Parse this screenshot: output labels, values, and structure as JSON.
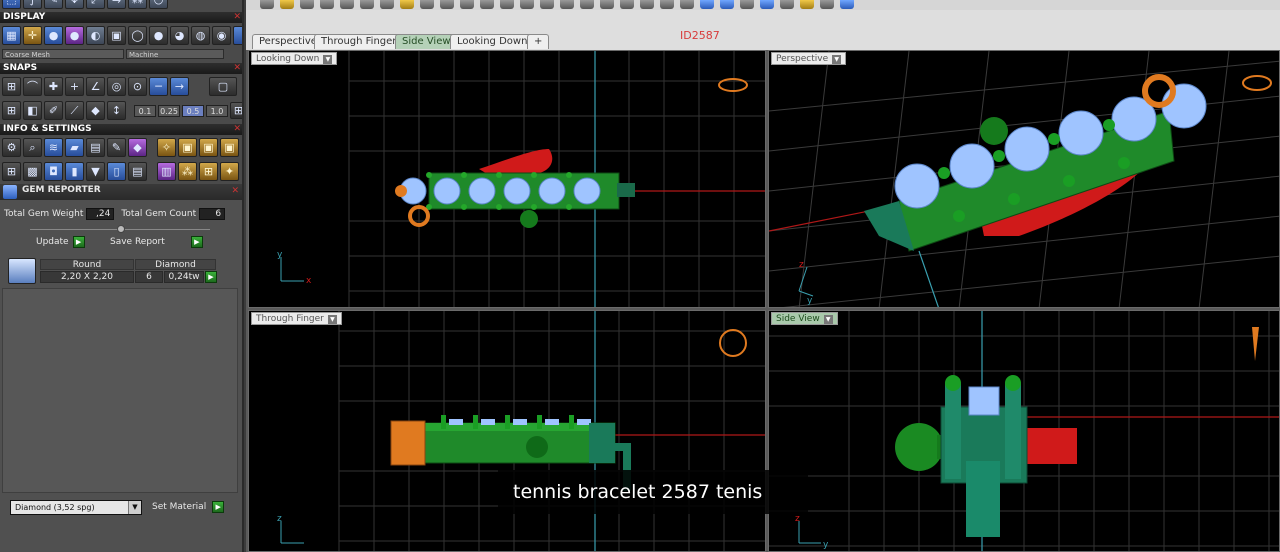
{
  "sections": {
    "display": "DISPLAY",
    "snaps": "SNAPS",
    "info": "INFO & SETTINGS",
    "gem_reporter": "GEM REPORTER"
  },
  "display": {
    "mesh_quality": "Coarse Mesh",
    "render_mode": "Machine"
  },
  "snaps": {
    "steps": [
      "0.1",
      "0.25",
      "0.5",
      "1.0"
    ],
    "selected_step": "0.5"
  },
  "gem_reporter": {
    "total_weight_label": "Total Gem Weight",
    "total_weight_value": ",24",
    "total_count_label": "Total Gem Count",
    "total_count_value": "6",
    "update_label": "Update",
    "save_report_label": "Save Report",
    "table": {
      "headers": [
        "Round",
        "Diamond"
      ],
      "row": {
        "size": "2,20 X 2,20",
        "count": "6",
        "weight": "0,24tw"
      }
    },
    "material_select": "Diamond    (3,52 spg)",
    "set_material_label": "Set Material"
  },
  "tabs": [
    {
      "label": "Perspective",
      "active": false
    },
    {
      "label": "Through Finger",
      "active": false
    },
    {
      "label": "Side View",
      "active": true
    },
    {
      "label": "Looking Down",
      "active": false
    },
    {
      "label": "+",
      "active": false
    }
  ],
  "model_id": "ID2587",
  "viewports": {
    "top_left": {
      "label": "Looking Down",
      "axis_v": "y",
      "axis_h": "x"
    },
    "top_right": {
      "label": "Perspective",
      "axis_v": "z",
      "axis_h": "y"
    },
    "bottom_left": {
      "label": "Through Finger",
      "axis_v": "z"
    },
    "bottom_right": {
      "label": "Side View",
      "axis_v": "z",
      "axis_h": "y"
    }
  },
  "caption": "tennis bracelet 2587 tenis",
  "colors": {
    "grid": "#3a3a3a",
    "metal_green": "#1f8a2a",
    "gem_blue": "#9fc4ff",
    "accent_red": "#d01a1a",
    "prong_orange": "#e07a20"
  }
}
